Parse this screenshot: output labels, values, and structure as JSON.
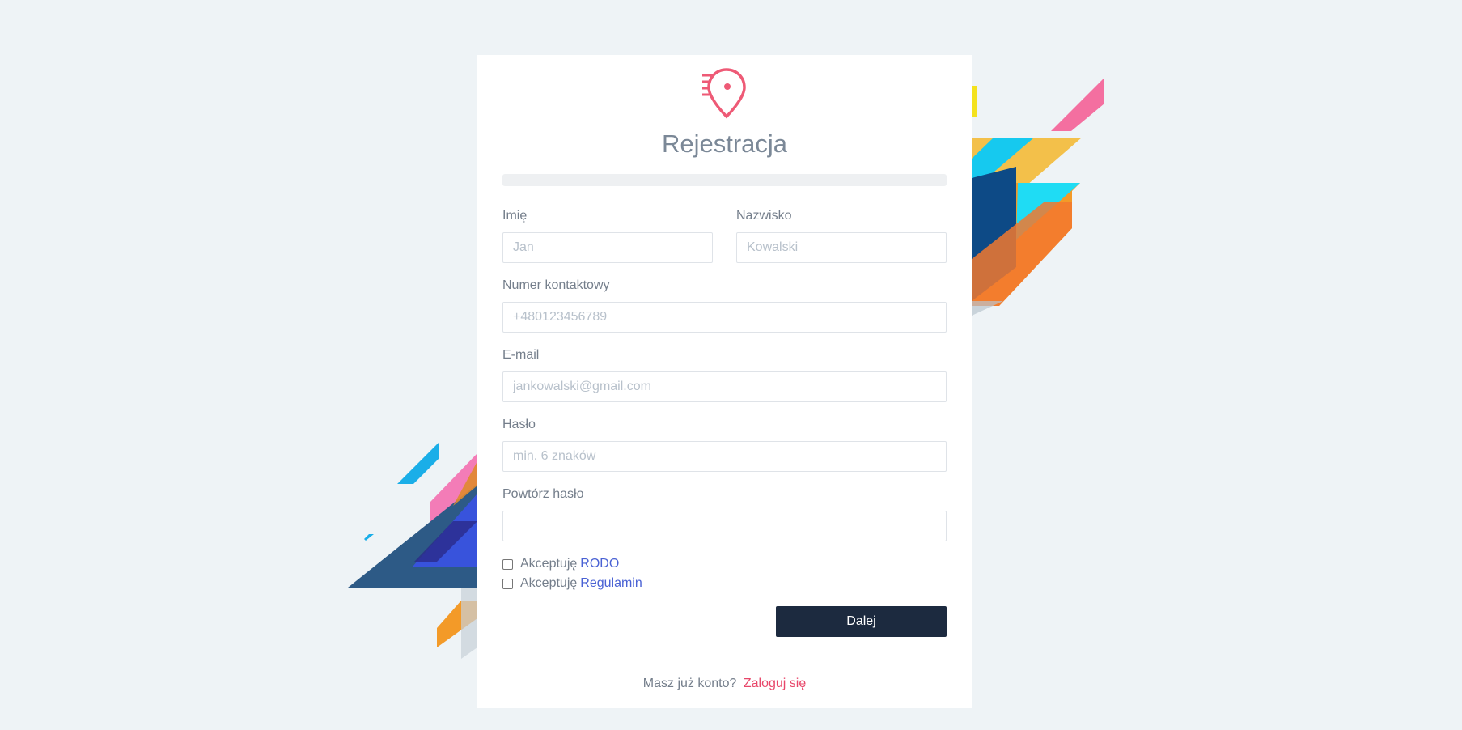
{
  "title": "Rejestracja",
  "registration_progress": 0,
  "fields": {
    "first_name": {
      "label": "Imię",
      "placeholder": "Jan",
      "value": ""
    },
    "last_name": {
      "label": "Nazwisko",
      "placeholder": "Kowalski",
      "value": ""
    },
    "phone": {
      "label": "Numer kontaktowy",
      "placeholder": "+480123456789",
      "value": ""
    },
    "email": {
      "label": "E-mail",
      "placeholder": "jankowalski@gmail.com",
      "value": ""
    },
    "password": {
      "label": "Hasło",
      "placeholder": "min. 6 znaków",
      "value": ""
    },
    "password_repeat": {
      "label": "Powtórz hasło",
      "placeholder": "",
      "value": ""
    }
  },
  "consents": {
    "rodo": {
      "prefix": "Akceptuję",
      "link": "RODO",
      "checked": false
    },
    "terms": {
      "prefix": "Akceptuję",
      "link": "Regulamin",
      "checked": false
    }
  },
  "submit_label": "Dalej",
  "footer": {
    "text": "Masz już konto?",
    "link": "Zaloguj się"
  },
  "colors": {
    "background": "#eef3f6",
    "brand": "#ee5a76",
    "button": "#1c2a3f",
    "link": "#4a62d4",
    "login_link": "#e8476a"
  },
  "icons": {
    "logo": "map-pin-speed-icon"
  }
}
